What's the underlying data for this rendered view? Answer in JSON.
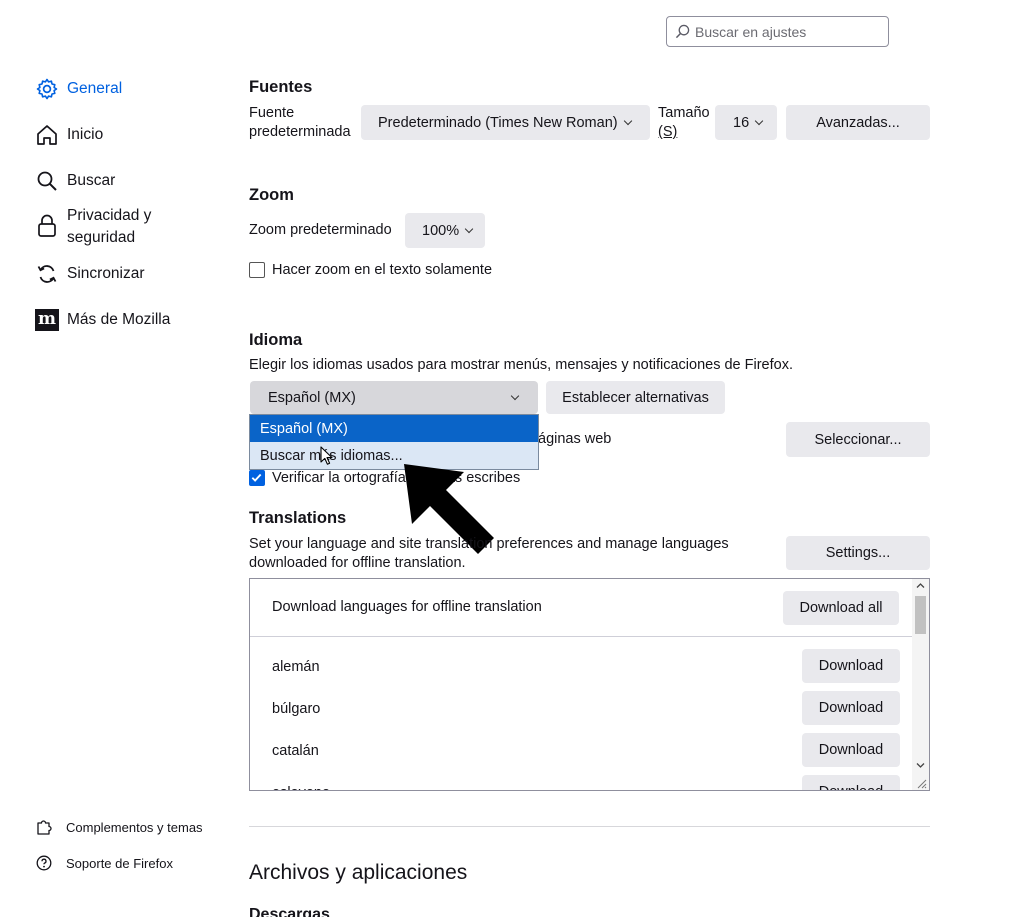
{
  "search": {
    "placeholder": "Buscar en ajustes"
  },
  "sidebar": {
    "items": [
      {
        "label": "General",
        "icon": "gear-icon",
        "active": true
      },
      {
        "label": "Inicio",
        "icon": "home-icon"
      },
      {
        "label": "Buscar",
        "icon": "search-icon"
      },
      {
        "label": "Privacidad y seguridad",
        "icon": "lock-icon"
      },
      {
        "label": "Sincronizar",
        "icon": "sync-icon"
      },
      {
        "label": "Más de Mozilla",
        "icon": "mozilla-icon"
      }
    ],
    "footer": [
      {
        "label": "Complementos y temas",
        "icon": "puzzle-icon"
      },
      {
        "label": "Soporte de Firefox",
        "icon": "help-icon"
      }
    ]
  },
  "fonts": {
    "title": "Fuentes",
    "default_label_1": "Fuente",
    "default_label_2": "predeterminada",
    "default_value": "Predeterminado (Times New Roman)",
    "size_label_1": "Tamaño",
    "size_label_2": "(S)",
    "size_value": "16",
    "advanced_button": "Avanzadas..."
  },
  "zoom": {
    "title": "Zoom",
    "default_label": "Zoom predeterminado",
    "default_value": "100%",
    "text_only_label": "Hacer zoom en el texto solamente",
    "text_only_checked": false
  },
  "language": {
    "title": "Idioma",
    "description": "Elegir los idiomas usados para mostrar menús, mensajes y notificaciones de Firefox.",
    "selected": "Español (MX)",
    "alternatives_button": "Establecer alternativas",
    "dropdown_options": [
      "Español (MX)",
      "Buscar más idiomas..."
    ],
    "pages_partial": "áginas web",
    "select_button": "Seleccionar...",
    "spell_partial_1": "Verificar la ortografía",
    "spell_partial_2": "tras escribes",
    "spell_checked": true
  },
  "translations": {
    "title": "Translations",
    "description_1": "Set your language and site translation preferences and manage languages",
    "description_2": "downloaded for offline translation.",
    "settings_button": "Settings...",
    "header_label": "Download languages for offline translation",
    "download_all_button": "Download all",
    "languages": [
      {
        "name": "alemán",
        "button": "Download"
      },
      {
        "name": "búlgaro",
        "button": "Download"
      },
      {
        "name": "catalán",
        "button": "Download"
      },
      {
        "name": "esloveno",
        "button": "Download"
      }
    ]
  },
  "files": {
    "title": "Archivos y aplicaciones",
    "downloads_partial": "Descargas"
  },
  "colors": {
    "accent": "#0061e0",
    "dropdown_selected_bg": "#0a64c8",
    "dropdown_hover_bg": "#dbe7f5"
  }
}
